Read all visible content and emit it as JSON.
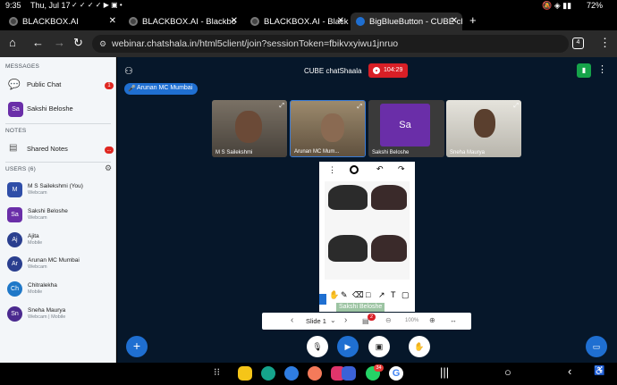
{
  "status_bar": {
    "time": "9:35",
    "date": "Thu, Jul 17",
    "battery": "72%"
  },
  "browser": {
    "tabs": [
      {
        "title": "BLACKBOX.AI",
        "active": false
      },
      {
        "title": "BLACKBOX.AI - Blackbo",
        "active": false
      },
      {
        "title": "BLACKBOX.AI - Blackbo",
        "active": false
      },
      {
        "title": "BigBlueButton - CUBE ch",
        "active": true
      }
    ],
    "new_tab": "+",
    "url": "webinar.chatshala.in/html5client/join?sessionToken=fbikvxyiwu1jnruo",
    "tab_count": "4"
  },
  "sidebar": {
    "messages_header": "MESSAGES",
    "messages": [
      {
        "label": "Public Chat",
        "badge": "1"
      },
      {
        "label": "Sakshi Beloshe",
        "avatar": "Sa"
      }
    ],
    "notes_header": "NOTES",
    "notes": [
      {
        "label": "Shared Notes",
        "badge": "..."
      }
    ],
    "users_header": "USERS (6)",
    "users": [
      {
        "initials": "M",
        "name": "M S Sailekshmi (You)",
        "sub": "Webcam",
        "color": "#2f4ea8",
        "square": true
      },
      {
        "initials": "Sa",
        "name": "Sakshi Beloshe",
        "sub": "Webcam",
        "color": "#6a2ea8",
        "square": true
      },
      {
        "initials": "Aj",
        "name": "Ajita",
        "sub": "Mobile",
        "color": "#2a3f8f",
        "square": false
      },
      {
        "initials": "Ar",
        "name": "Arunan MC Mumbai",
        "sub": "Webcam",
        "color": "#2a3f8f",
        "square": false
      },
      {
        "initials": "Ch",
        "name": "Chitralekha",
        "sub": "Mobile",
        "color": "#1f78c8",
        "square": false
      },
      {
        "initials": "Sn",
        "name": "Sneha Maurya",
        "sub": "Webcam | Mobile",
        "color": "#4b2a8f",
        "square": false
      }
    ]
  },
  "meeting": {
    "title": "CUBE chatShaala",
    "recording_time": "104:29",
    "talking_indicator": "Arunan MC Mumbai",
    "videos": [
      {
        "name": "M S Sailekshmi"
      },
      {
        "name": "Arunan MC Mum..."
      },
      {
        "name": "Sakshi Beloshe",
        "initials": "Sa"
      },
      {
        "name": "Sneha Maurya"
      }
    ],
    "presentation": {
      "annotation_user": "Sakshi Beloshe",
      "slide_label": "Slide 1",
      "zoom": "100%",
      "annotation_count": "2"
    }
  },
  "colors": {
    "main_bg": "#06172a",
    "accent_blue": "#1f6fd1",
    "recording_red": "#d81f26",
    "sidebar_bg": "#f3f6f9"
  },
  "android_nav": {
    "whatsapp_badge": "34"
  }
}
